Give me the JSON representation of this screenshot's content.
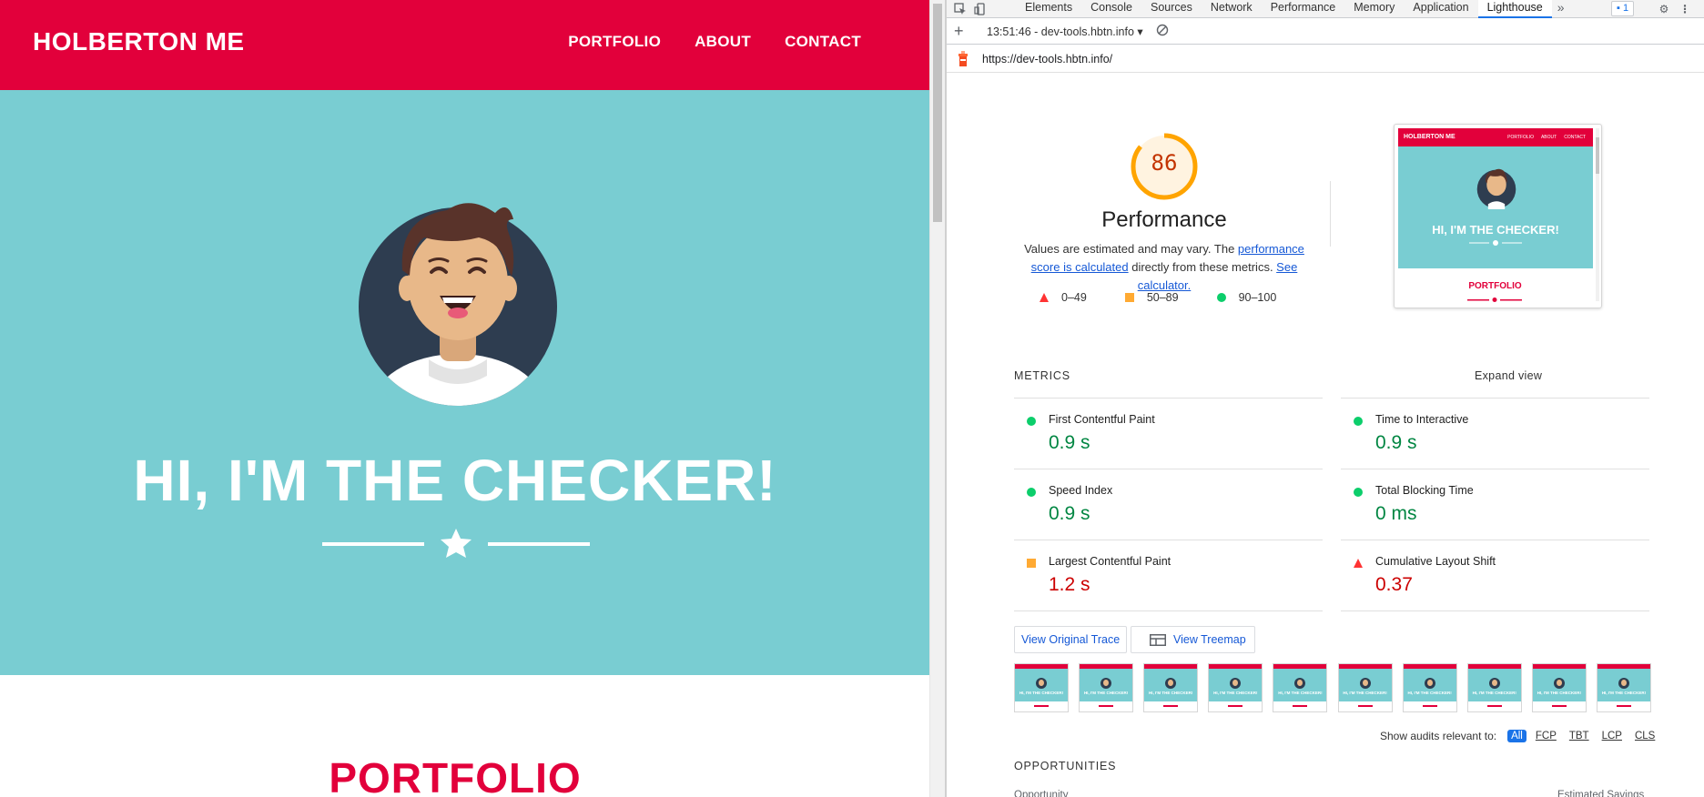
{
  "site": {
    "brand": "HOLBERTON ME",
    "nav": [
      "PORTFOLIO",
      "ABOUT",
      "CONTACT"
    ],
    "hero_title": "HI, I'M THE CHECKER!",
    "portfolio_heading": "PORTFOLIO",
    "colors": {
      "primary": "#e2003b",
      "hero": "#79cdd2"
    }
  },
  "devtools": {
    "tabs": [
      "Elements",
      "Console",
      "Sources",
      "Network",
      "Performance",
      "Memory",
      "Application",
      "Lighthouse"
    ],
    "active_tab": "Lighthouse",
    "more_tabs": "»",
    "issues_count": "1",
    "report_select": "13:51:46 - dev-tools.hbtn.info ▾",
    "url": "https://dev-tools.hbtn.info/"
  },
  "lighthouse": {
    "score": "86",
    "score_fraction": 0.86,
    "category": "Performance",
    "desc_prefix": "Values are estimated and may vary. The ",
    "desc_link1": "performance score is calculated",
    "desc_mid": " directly from these metrics. ",
    "desc_link2": "See calculator.",
    "legend": [
      {
        "range": "0–49",
        "shape": "triangle"
      },
      {
        "range": "50–89",
        "shape": "square"
      },
      {
        "range": "90–100",
        "shape": "circle"
      }
    ],
    "thumb": {
      "brand": "HOLBERTON ME",
      "links": [
        "PORTFOLIO",
        "ABOUT",
        "CONTACT"
      ],
      "title": "HI, I'M THE CHECKER!",
      "portfolio": "PORTFOLIO"
    },
    "metrics_header": "METRICS",
    "expand_view": "Expand view",
    "metrics": [
      {
        "label": "First Contentful Paint",
        "value": "0.9 s",
        "rating": "good"
      },
      {
        "label": "Time to Interactive",
        "value": "0.9 s",
        "rating": "good"
      },
      {
        "label": "Speed Index",
        "value": "0.9 s",
        "rating": "good"
      },
      {
        "label": "Total Blocking Time",
        "value": "0 ms",
        "rating": "good"
      },
      {
        "label": "Largest Contentful Paint",
        "value": "1.2 s",
        "rating": "average"
      },
      {
        "label": "Cumulative Layout Shift",
        "value": "0.37",
        "rating": "poor"
      }
    ],
    "view_trace": "View Original Trace",
    "view_treemap": "View Treemap",
    "filmstrip_frames": 10,
    "frame_text": "HI, I'M THE CHECKER!",
    "filter_label": "Show audits relevant to:",
    "filters": [
      "All",
      "FCP",
      "TBT",
      "LCP",
      "CLS"
    ],
    "active_filter": "All",
    "opportunities_header": "OPPORTUNITIES",
    "opp_col1": "Opportunity",
    "opp_col2": "Estimated Savings"
  }
}
